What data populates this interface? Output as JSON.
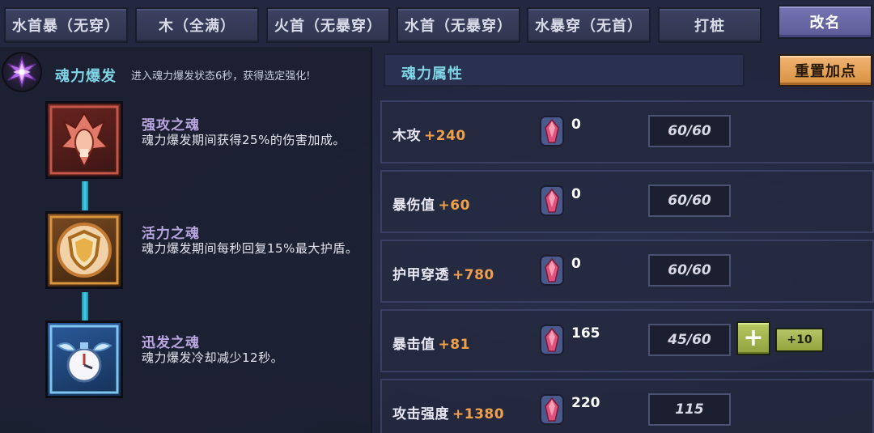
{
  "tabs": [
    {
      "label": "水首暴（无穿）"
    },
    {
      "label": "木（全满）"
    },
    {
      "label": "火首（无暴穿）"
    },
    {
      "label": "水首（无暴穿）"
    },
    {
      "label": "水暴穿（无首）"
    },
    {
      "label": "打桩"
    }
  ],
  "rename_label": "改名",
  "soul_burst": {
    "title": "魂力爆发",
    "description": "进入魂力爆发状态6秒，获得选定强化!"
  },
  "skills": [
    {
      "name": "强攻之魂",
      "description": "魂力爆发期间获得25%的伤害加成。",
      "icon": "red-fist-icon"
    },
    {
      "name": "活力之魂",
      "description": "魂力爆发期间每秒回复15%最大护盾。",
      "icon": "golden-shield-icon"
    },
    {
      "name": "迅发之魂",
      "description": "魂力爆发冷却减少12秒。",
      "icon": "winged-clock-icon"
    }
  ],
  "attributes_panel": {
    "title": "魂力属性",
    "reset_label": "重置加点",
    "rows": [
      {
        "name": "木攻",
        "bonus": "+240",
        "stones": "0",
        "value": "60/60",
        "show_add": false
      },
      {
        "name": "暴伤值",
        "bonus": "+60",
        "stones": "0",
        "value": "60/60",
        "show_add": false
      },
      {
        "name": "护甲穿透",
        "bonus": "+780",
        "stones": "0",
        "value": "60/60",
        "show_add": false
      },
      {
        "name": "暴击值",
        "bonus": "+81",
        "stones": "165",
        "value": "45/60",
        "show_add": true,
        "plus_label": "+",
        "plus10_label": "+10"
      },
      {
        "name": "攻击强度",
        "bonus": "+1380",
        "stones": "220",
        "value": "115",
        "show_add": false
      }
    ]
  },
  "colors": {
    "title_cyan": "#7fd4e6",
    "skill_name_purple": "#b9a6e0",
    "bonus_orange": "#f0a04a",
    "rename_purple": "#6a69a6",
    "reset_orange": "#e5a35a",
    "plus_green": "#a4b650"
  }
}
